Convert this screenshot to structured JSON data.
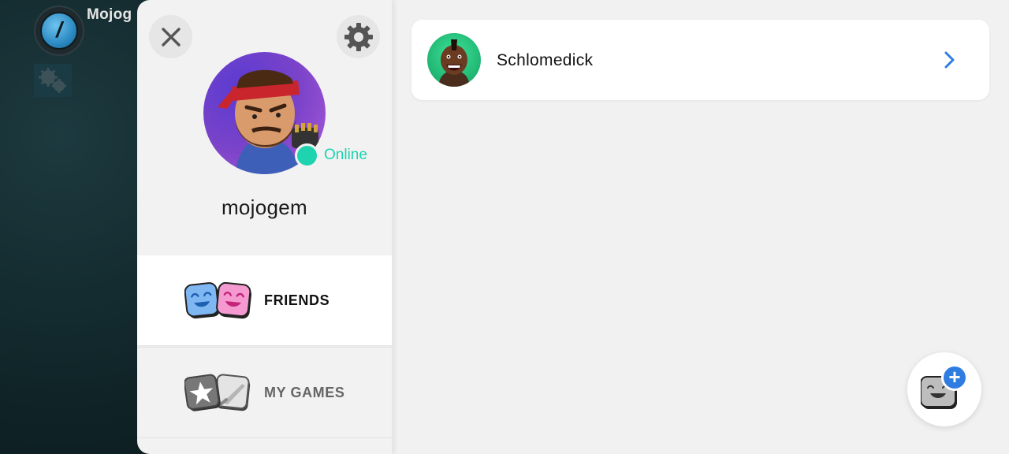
{
  "game": {
    "title": "Mojog",
    "logo_glyph": "/"
  },
  "profile": {
    "username": "mojogem",
    "status": "Online",
    "status_color": "#1dd3b0"
  },
  "tabs": [
    {
      "label": "FRIENDS",
      "active": true
    },
    {
      "label": "MY GAMES",
      "active": false
    }
  ],
  "friends": [
    {
      "name": "Schlomedick"
    }
  ],
  "fab": {
    "symbol": "+"
  },
  "colors": {
    "accent_blue": "#2f7de1",
    "online_green": "#1dd3b0"
  }
}
